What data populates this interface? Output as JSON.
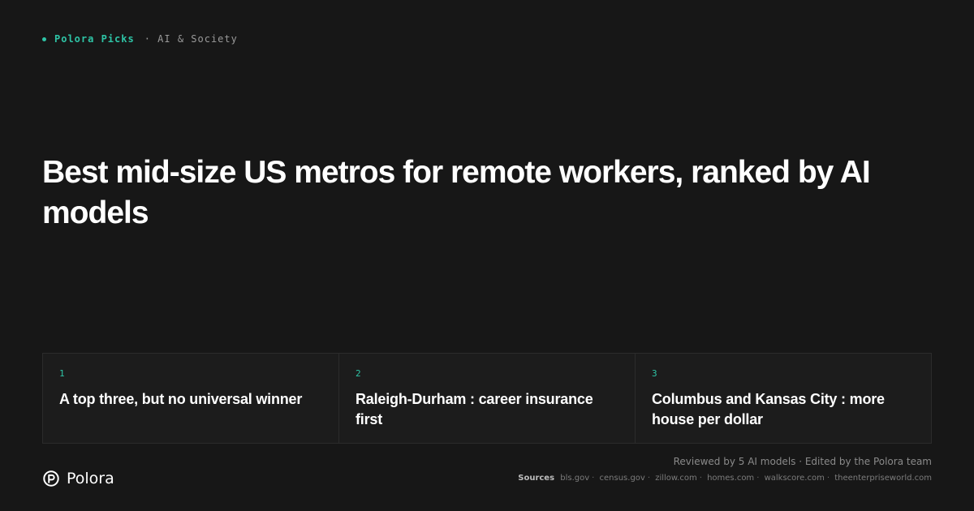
{
  "eyebrow": {
    "brand": "Polora Picks",
    "category": "· AI & Society"
  },
  "headline": "Best mid-size US metros for remote workers, ranked by AI models",
  "cards": [
    {
      "number": "1",
      "title": "A top three, but no universal winner"
    },
    {
      "number": "2",
      "title": "Raleigh-Durham : career insurance first"
    },
    {
      "number": "3",
      "title": "Columbus and Kansas City : more house per dollar"
    }
  ],
  "footer": {
    "logo_name": "Polora",
    "reviewed": "Reviewed by 5 AI models · Edited by the Polora team",
    "sources_label": "Sources",
    "sources": [
      "bls.gov",
      "census.gov",
      "zillow.com",
      "homes.com",
      "walkscore.com",
      "theenterpriseworld.com"
    ]
  },
  "colors": {
    "background": "#171717",
    "accent": "#2ec4a6",
    "card_bg": "#1c1c1c",
    "border": "#2b2b2b"
  },
  "icons": {
    "logo": "polora-logo-icon",
    "bullet": "dot-icon"
  }
}
